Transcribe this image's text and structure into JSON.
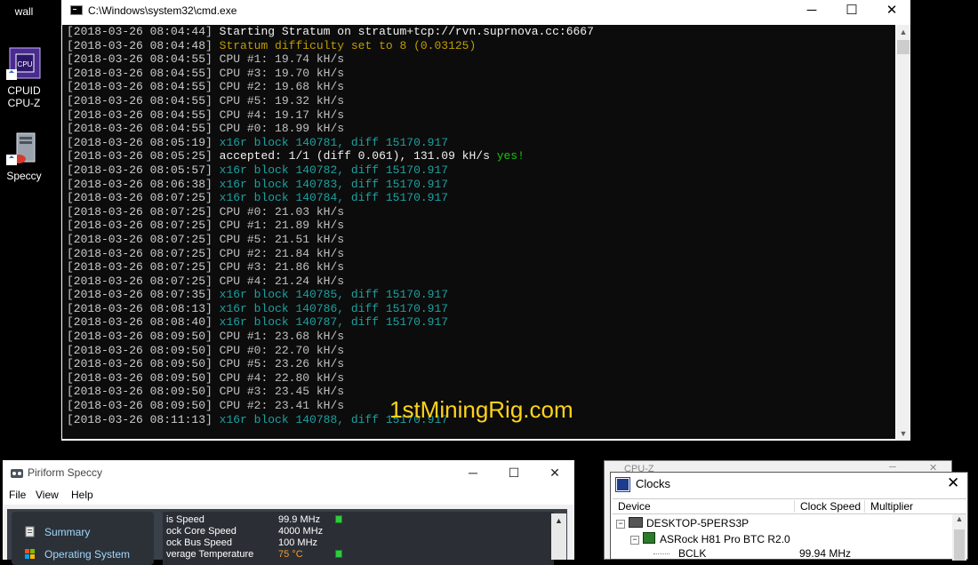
{
  "desktop": {
    "icons": [
      {
        "label": "wall"
      },
      {
        "label": "CPUID\nCPU-Z"
      },
      {
        "label": "Speccy"
      }
    ]
  },
  "cmd": {
    "title": "C:\\Windows\\system32\\cmd.exe",
    "lines": [
      {
        "ts": "[2018-03-26 08:04:44]",
        "msg": "Starting Stratum on stratum+tcp://rvn.suprnova.cc:6667",
        "color": "white"
      },
      {
        "ts": "[2018-03-26 08:04:48]",
        "msg": "Stratum difficulty set to 8 (0.03125)",
        "color": "yellow"
      },
      {
        "ts": "[2018-03-26 08:04:55]",
        "msg": "CPU #1: 19.74 kH/s",
        "color": "default"
      },
      {
        "ts": "[2018-03-26 08:04:55]",
        "msg": "CPU #3: 19.70 kH/s",
        "color": "default"
      },
      {
        "ts": "[2018-03-26 08:04:55]",
        "msg": "CPU #2: 19.68 kH/s",
        "color": "default"
      },
      {
        "ts": "[2018-03-26 08:04:55]",
        "msg": "CPU #5: 19.32 kH/s",
        "color": "default"
      },
      {
        "ts": "[2018-03-26 08:04:55]",
        "msg": "CPU #4: 19.17 kH/s",
        "color": "default"
      },
      {
        "ts": "[2018-03-26 08:04:55]",
        "msg": "CPU #0: 18.99 kH/s",
        "color": "default"
      },
      {
        "ts": "[2018-03-26 08:05:19]",
        "msg": "x16r block 140781, diff 15170.917",
        "color": "teal"
      },
      {
        "ts": "[2018-03-26 08:05:25]",
        "msg": "accepted: 1/1 (diff 0.061), 131.09 kH/s ",
        "color": "white",
        "suffix": "yes!"
      },
      {
        "ts": "[2018-03-26 08:05:57]",
        "msg": "x16r block 140782, diff 15170.917",
        "color": "teal"
      },
      {
        "ts": "[2018-03-26 08:06:38]",
        "msg": "x16r block 140783, diff 15170.917",
        "color": "teal"
      },
      {
        "ts": "[2018-03-26 08:07:25]",
        "msg": "x16r block 140784, diff 15170.917",
        "color": "teal"
      },
      {
        "ts": "[2018-03-26 08:07:25]",
        "msg": "CPU #0: 21.03 kH/s",
        "color": "default"
      },
      {
        "ts": "[2018-03-26 08:07:25]",
        "msg": "CPU #1: 21.89 kH/s",
        "color": "default"
      },
      {
        "ts": "[2018-03-26 08:07:25]",
        "msg": "CPU #5: 21.51 kH/s",
        "color": "default"
      },
      {
        "ts": "[2018-03-26 08:07:25]",
        "msg": "CPU #2: 21.84 kH/s",
        "color": "default"
      },
      {
        "ts": "[2018-03-26 08:07:25]",
        "msg": "CPU #3: 21.86 kH/s",
        "color": "default"
      },
      {
        "ts": "[2018-03-26 08:07:25]",
        "msg": "CPU #4: 21.24 kH/s",
        "color": "default"
      },
      {
        "ts": "[2018-03-26 08:07:35]",
        "msg": "x16r block 140785, diff 15170.917",
        "color": "teal"
      },
      {
        "ts": "[2018-03-26 08:08:13]",
        "msg": "x16r block 140786, diff 15170.917",
        "color": "teal"
      },
      {
        "ts": "[2018-03-26 08:08:40]",
        "msg": "x16r block 140787, diff 15170.917",
        "color": "teal"
      },
      {
        "ts": "[2018-03-26 08:09:50]",
        "msg": "CPU #1: 23.68 kH/s",
        "color": "default"
      },
      {
        "ts": "[2018-03-26 08:09:50]",
        "msg": "CPU #0: 22.70 kH/s",
        "color": "default"
      },
      {
        "ts": "[2018-03-26 08:09:50]",
        "msg": "CPU #5: 23.26 kH/s",
        "color": "default"
      },
      {
        "ts": "[2018-03-26 08:09:50]",
        "msg": "CPU #4: 22.80 kH/s",
        "color": "default"
      },
      {
        "ts": "[2018-03-26 08:09:50]",
        "msg": "CPU #3: 23.45 kH/s",
        "color": "default"
      },
      {
        "ts": "[2018-03-26 08:09:50]",
        "msg": "CPU #2: 23.41 kH/s",
        "color": "default"
      },
      {
        "ts": "[2018-03-26 08:11:13]",
        "msg": "x16r block 140788, diff 15170.917",
        "color": "teal"
      }
    ]
  },
  "watermark": "1stMiningRig.com",
  "speccy": {
    "title": "Piriform Speccy",
    "menu": [
      "File",
      "View",
      "Help"
    ],
    "nav": [
      {
        "label": "Summary",
        "icon": "summary-icon"
      },
      {
        "label": "Operating System",
        "icon": "windows-icon"
      }
    ],
    "rows": [
      {
        "label": "is Speed",
        "value": "99.9 MHz",
        "bar": true
      },
      {
        "label": "ock Core Speed",
        "value": "4000 MHz",
        "bar": false
      },
      {
        "label": "ock Bus Speed",
        "value": "100 MHz",
        "bar": false
      },
      {
        "label": "verage Temperature",
        "value": "75 °C",
        "bar": true
      }
    ],
    "colors": {
      "hot": "#f39b34",
      "bar": "#2ecc40"
    }
  },
  "cpuz": {
    "title": "CPU-Z"
  },
  "clocks": {
    "title": "Clocks",
    "columns": [
      "Device",
      "Clock Speed",
      "Multiplier"
    ],
    "tree": [
      {
        "label": "DESKTOP-5PERS3P",
        "speed": ""
      },
      {
        "label": "ASRock H81 Pro BTC R2.0",
        "speed": ""
      },
      {
        "label": "BCLK",
        "speed": "99.94 MHz"
      }
    ]
  }
}
